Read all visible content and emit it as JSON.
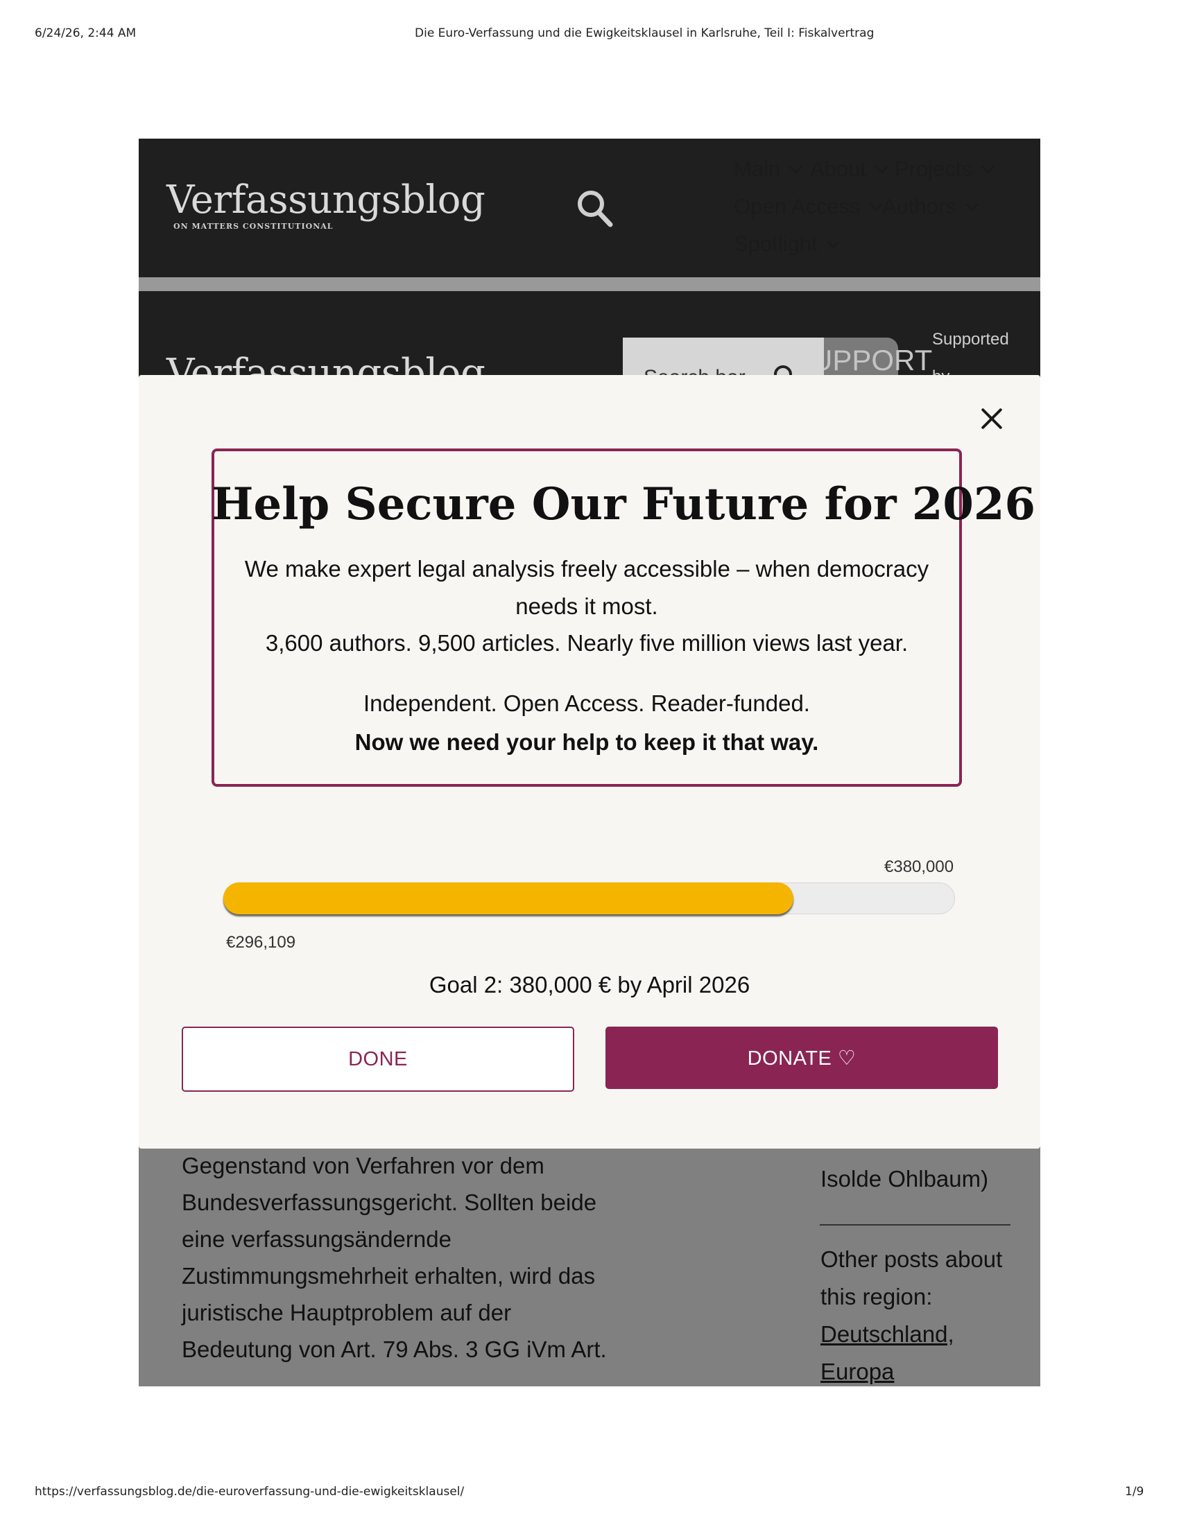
{
  "print": {
    "datetime": "6/24/26, 2:44 AM",
    "doc_title": "Die Euro-Verfassung und die Ewigkeitsklausel in Karlsruhe, Teil I: Fiskalvertrag",
    "url": "https://verfassungsblog.de/die-euroverfassung-und-die-ewigkeitsklausel/",
    "page": "1/9"
  },
  "header": {
    "logo_title": "Verfassungsblog",
    "logo_subtitle": "ON MATTERS CONSTITUTIONAL",
    "nav": [
      "Main",
      "About",
      "Projects",
      "Open Access",
      "Authors",
      "Spotlight"
    ]
  },
  "sticky": {
    "logo_title": "Verfassungsblog",
    "search_placeholder": "Search bar",
    "support_label": "SUPPORT",
    "supported_label": "Supported",
    "supported_by": "by"
  },
  "modal": {
    "headline": "Help Secure Our Future for 2026",
    "lines": [
      "We make expert legal analysis freely accessible – when democracy",
      "needs it most.",
      "3,600 authors. 9,500 articles. Nearly five million views last year.",
      "Independent. Open Access. Reader-funded."
    ],
    "bold_line": "Now we need your help to keep it that way.",
    "goal_amount": "€380,000",
    "current_amount": "€296,109",
    "progress_fraction": 0.779,
    "goal_text": "Goal 2: 380,000 € by April 2026",
    "done_label": "DONE",
    "donate_label": "DONATE ♡"
  },
  "article": {
    "lines": [
      "Gegenstand von Verfahren vor dem",
      "Bundesverfassungsgericht. Sollten beide",
      "eine verfassungsändernde",
      "Zustimmungsmehrheit erhalten, wird das",
      "juristische Hauptproblem auf der",
      "Bedeutung von Art. 79 Abs. 3 GG iVm Art."
    ]
  },
  "sidebar": {
    "photo_credit_tail": "Isolde Ohlbaum)",
    "other_posts": "Other posts about",
    "this_region": "this region:",
    "links": [
      "Deutschland,",
      "Europa"
    ]
  },
  "colors": {
    "brand": "#8a2553",
    "progress": "#f4b400",
    "header_bg": "#1f1f1f"
  }
}
